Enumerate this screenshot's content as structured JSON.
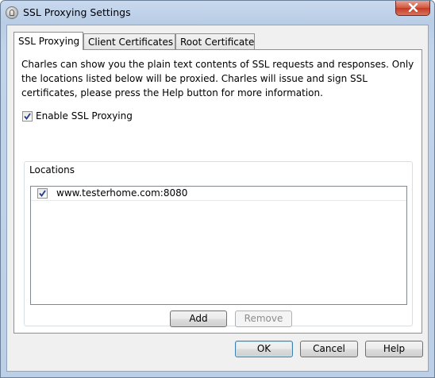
{
  "window": {
    "title": "SSL Proxying Settings"
  },
  "tabs": [
    {
      "label": "SSL Proxying",
      "active": true
    },
    {
      "label": "Client Certificates",
      "active": false
    },
    {
      "label": "Root Certificate",
      "active": false
    }
  ],
  "ssl_tab": {
    "description": "Charles can show you the plain text contents of SSL requests and responses. Only the locations listed below will be proxied. Charles will issue and sign SSL certificates, please press the Help button for more information.",
    "enable_label": "Enable SSL Proxying",
    "enable_checked": true,
    "locations": {
      "group_label": "Locations",
      "items": [
        {
          "host": "www.testerhome.com:8080",
          "checked": true
        }
      ],
      "add_label": "Add",
      "remove_label": "Remove",
      "remove_enabled": false
    }
  },
  "footer": {
    "ok_label": "OK",
    "cancel_label": "Cancel",
    "help_label": "Help"
  }
}
